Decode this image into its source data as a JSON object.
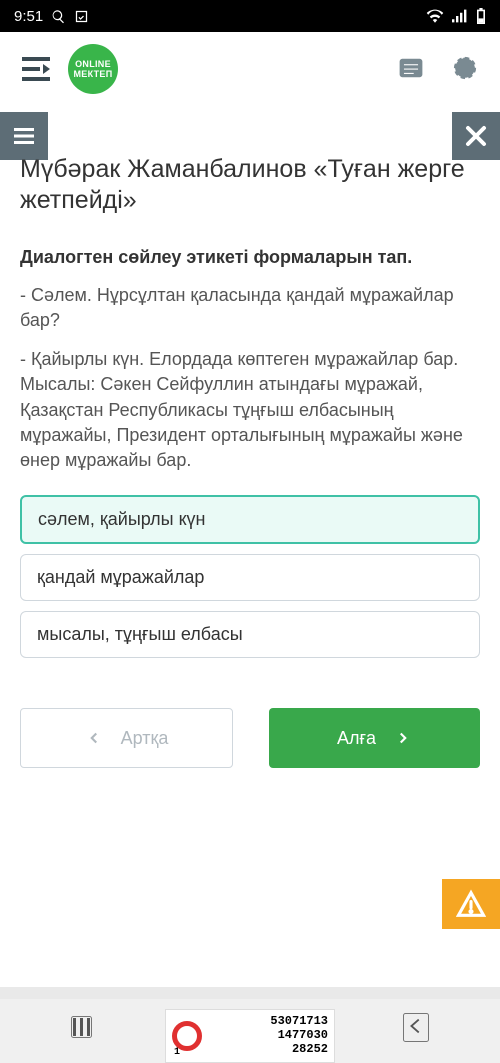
{
  "status": {
    "time": "9:51"
  },
  "logo": {
    "line1": "ONLINE",
    "line2": "МЕКТЕП"
  },
  "page": {
    "title": "Мүбәрак Жаманбалинов «Туған жерге жетпейді»",
    "prompt": "Диалогтен сөйлеу этикеті формаларын тап.",
    "paragraph1": "- Сәлем. Нұрсұлтан қаласында қандай мұражайлар бар?",
    "paragraph2": "- Қайырлы күн. Елордада көптеген мұражайлар бар. Мысалы: Сәкен Сейфуллин атындағы мұражай, Қазақстан Республикасы тұңғыш елбасының мұражайы, Президент орталығының мұражайы және өнер мұражайы бар."
  },
  "options": [
    {
      "label": "сәлем, қайырлы күн",
      "selected": true
    },
    {
      "label": "қандай мұражайлар",
      "selected": false
    },
    {
      "label": "мысалы, тұңғыш елбасы",
      "selected": false
    }
  ],
  "nav": {
    "back": "Артқа",
    "forward": "Алға"
  },
  "captcha": {
    "line1": "53071713",
    "line2": "1477030",
    "line3": "28252",
    "corner": "1"
  }
}
